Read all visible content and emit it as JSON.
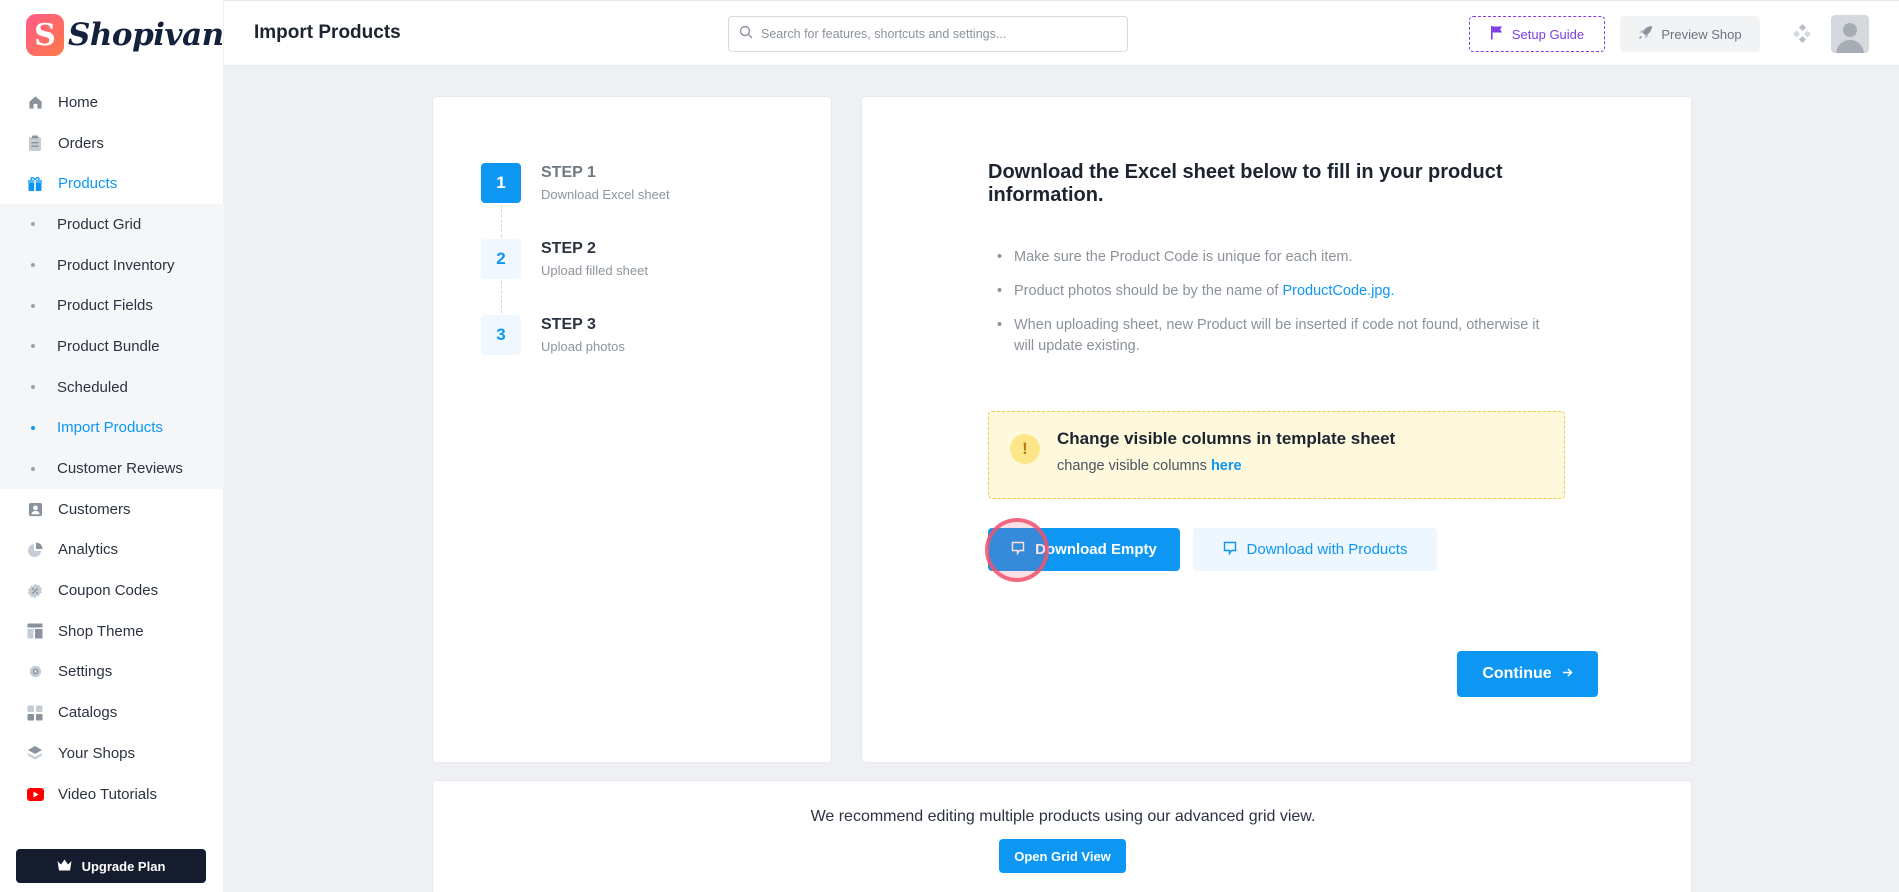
{
  "app": {
    "brand": "Shopivana",
    "brand_initial": "S"
  },
  "header": {
    "title": "Import Products",
    "search_placeholder": "Search for features, shortcuts and settings...",
    "setup_guide_label": "Setup Guide",
    "preview_shop_label": "Preview Shop"
  },
  "sidebar": {
    "items": [
      {
        "label": "Home",
        "icon": "home-icon"
      },
      {
        "label": "Orders",
        "icon": "clipboard-icon"
      },
      {
        "label": "Products",
        "icon": "gift-icon",
        "active": true
      },
      {
        "label": "Customers",
        "icon": "user-card-icon"
      },
      {
        "label": "Analytics",
        "icon": "pie-chart-icon"
      },
      {
        "label": "Coupon Codes",
        "icon": "coupon-icon"
      },
      {
        "label": "Shop Theme",
        "icon": "layout-icon"
      },
      {
        "label": "Settings",
        "icon": "gear-icon"
      },
      {
        "label": "Catalogs",
        "icon": "grid-icon"
      },
      {
        "label": "Your Shops",
        "icon": "layers-icon"
      },
      {
        "label": "Video Tutorials",
        "icon": "youtube-icon"
      }
    ],
    "product_subitems": [
      {
        "label": "Product Grid"
      },
      {
        "label": "Product Inventory"
      },
      {
        "label": "Product Fields"
      },
      {
        "label": "Product Bundle"
      },
      {
        "label": "Scheduled"
      },
      {
        "label": "Import Products",
        "active": true
      },
      {
        "label": "Customer Reviews"
      }
    ],
    "upgrade_label": "Upgrade Plan"
  },
  "steps": [
    {
      "number": "1",
      "title": "STEP 1",
      "subtitle": "Download Excel sheet",
      "active": true
    },
    {
      "number": "2",
      "title": "STEP 2",
      "subtitle": "Upload filled sheet",
      "active": false
    },
    {
      "number": "3",
      "title": "STEP 3",
      "subtitle": "Upload photos",
      "active": false
    }
  ],
  "main": {
    "title": "Download the Excel sheet below to fill in your product information.",
    "bullet1": "Make sure the Product Code is unique for each item.",
    "bullet2_prefix": "Product photos should be by the name of ",
    "bullet2_link": "ProductCode.jpg.",
    "bullet3": "When uploading sheet, new Product will be inserted if code not found, otherwise it will update existing.",
    "notice_title": "Change visible columns in template sheet",
    "notice_prefix": "change visible columns ",
    "notice_link": "here",
    "download_empty_label": "Download Empty",
    "download_products_label": "Download with Products",
    "continue_label": "Continue"
  },
  "footer": {
    "recommend_text": "We recommend editing multiple products using our advanced grid view.",
    "open_grid_label": "Open Grid View"
  },
  "colors": {
    "accent": "#0d97f2",
    "setup": "#7b3fe4",
    "notice_bg": "#fef8dd",
    "sidebar_dark": "#141c2e"
  }
}
